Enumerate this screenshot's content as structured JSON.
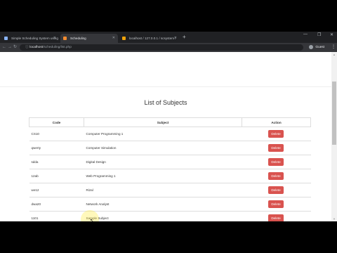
{
  "browser": {
    "tabs": [
      {
        "label": "Simple Scheduling System using",
        "active": false
      },
      {
        "label": "Scheduling",
        "active": true
      },
      {
        "label": "localhost / 127.0.0.1 / scsystem /",
        "active": false
      }
    ],
    "address": {
      "host": "localhost",
      "path": "/scheduling/list.php"
    },
    "profile": "Guest"
  },
  "page": {
    "title": "List of Subjects",
    "columns": [
      "Code",
      "Subject",
      "Action"
    ],
    "rows": [
      {
        "code": "CS10",
        "subject": "Computer Programming 1",
        "action": "Delete"
      },
      {
        "code": "qwerty",
        "subject": "Computer Simulation",
        "action": "Delete"
      },
      {
        "code": "sdda",
        "subject": "Digital Design",
        "action": "Delete"
      },
      {
        "code": "12ab",
        "subject": "Web Programming 1",
        "action": "Delete"
      },
      {
        "code": "we12",
        "subject": "Rizal",
        "action": "Delete"
      },
      {
        "code": "dwa20",
        "subject": "Network Analyst",
        "action": "Delete"
      },
      {
        "code": "1101",
        "subject": "Sample Subject",
        "action": "Delete"
      }
    ]
  },
  "colors": {
    "delete_button": "#d9534f",
    "chrome_dark": "#202124",
    "chrome_toolbar": "#35363a"
  },
  "icons": [
    "globe-icon",
    "close-icon",
    "new-tab-icon",
    "back-arrow-icon",
    "forward-arrow-icon",
    "reload-icon",
    "info-icon",
    "guest-avatar-icon",
    "menu-icon",
    "mouse-pointer-icon"
  ]
}
